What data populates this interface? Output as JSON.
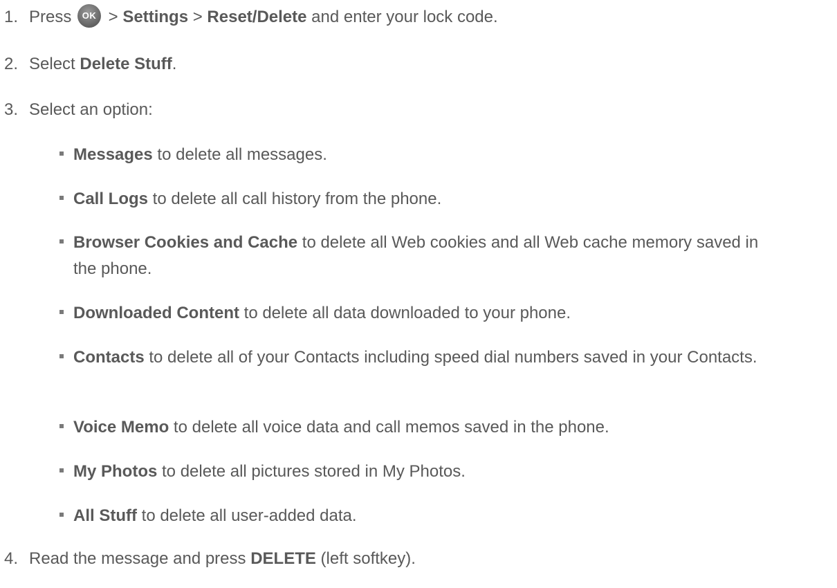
{
  "steps": [
    {
      "num": "1.",
      "pre": "Press ",
      "button_label": "OK",
      "sep1": " > ",
      "b1": "Settings",
      "sep2": " > ",
      "b2": "Reset/Delete",
      "post": " and enter your lock code."
    },
    {
      "num": "2.",
      "pre": "Select ",
      "b1": "Delete Stuff",
      "post": "."
    },
    {
      "num": "3.",
      "text": "Select an option:"
    },
    {
      "num": "4.",
      "pre": "Read the message and press ",
      "b1": "DELETE",
      "post": " (left softkey)."
    }
  ],
  "options": [
    {
      "bold": "Messages",
      "rest": " to delete all messages."
    },
    {
      "bold": "Call Logs",
      "rest": " to delete all call history from the phone."
    },
    {
      "bold": "Browser Cookies and Cache",
      "rest": " to delete all Web cookies and all Web cache memory saved in the phone."
    },
    {
      "bold": "Downloaded Content",
      "rest": " to delete all data downloaded to your phone."
    },
    {
      "bold": "Contacts",
      "rest": " to delete all of your Contacts including speed dial numbers saved in your Contacts."
    },
    {
      "bold": "Voice Memo",
      "rest": " to delete all voice data and call memos saved in the phone."
    },
    {
      "bold": "My Photos",
      "rest": " to delete all pictures stored in My Photos."
    },
    {
      "bold": "All Stuff",
      "rest": " to delete all user-added data."
    }
  ],
  "icons": {
    "ok_button": "ok-key-icon",
    "bullet": "square-bullet-icon"
  },
  "colors": {
    "text": "#595959",
    "ok_button": "#6e6e6e"
  }
}
